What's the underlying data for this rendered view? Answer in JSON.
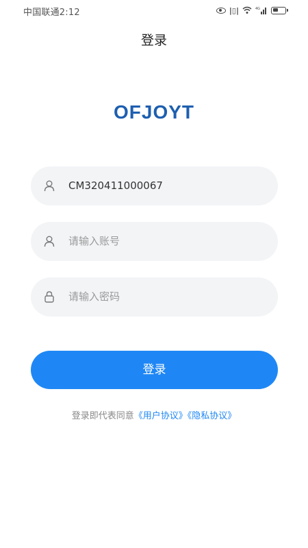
{
  "status_bar": {
    "carrier_time": "中国联通2:12",
    "network_type": "4G"
  },
  "header": {
    "title": "登录"
  },
  "logo": {
    "text": "OFJOYT"
  },
  "form": {
    "username": {
      "value": "CM320411000067",
      "icon": "user-icon"
    },
    "account": {
      "placeholder": "请输入账号",
      "icon": "user-icon"
    },
    "password": {
      "placeholder": "请输入密码",
      "icon": "lock-icon"
    }
  },
  "login_button": {
    "label": "登录"
  },
  "agreement": {
    "prefix": "登录即代表同意",
    "user_agreement": "《用户协议》",
    "privacy_policy": "《隐私协议》"
  },
  "colors": {
    "primary": "#1f87f5",
    "logo": "#1d5fb0",
    "field_bg": "#f3f4f6"
  }
}
